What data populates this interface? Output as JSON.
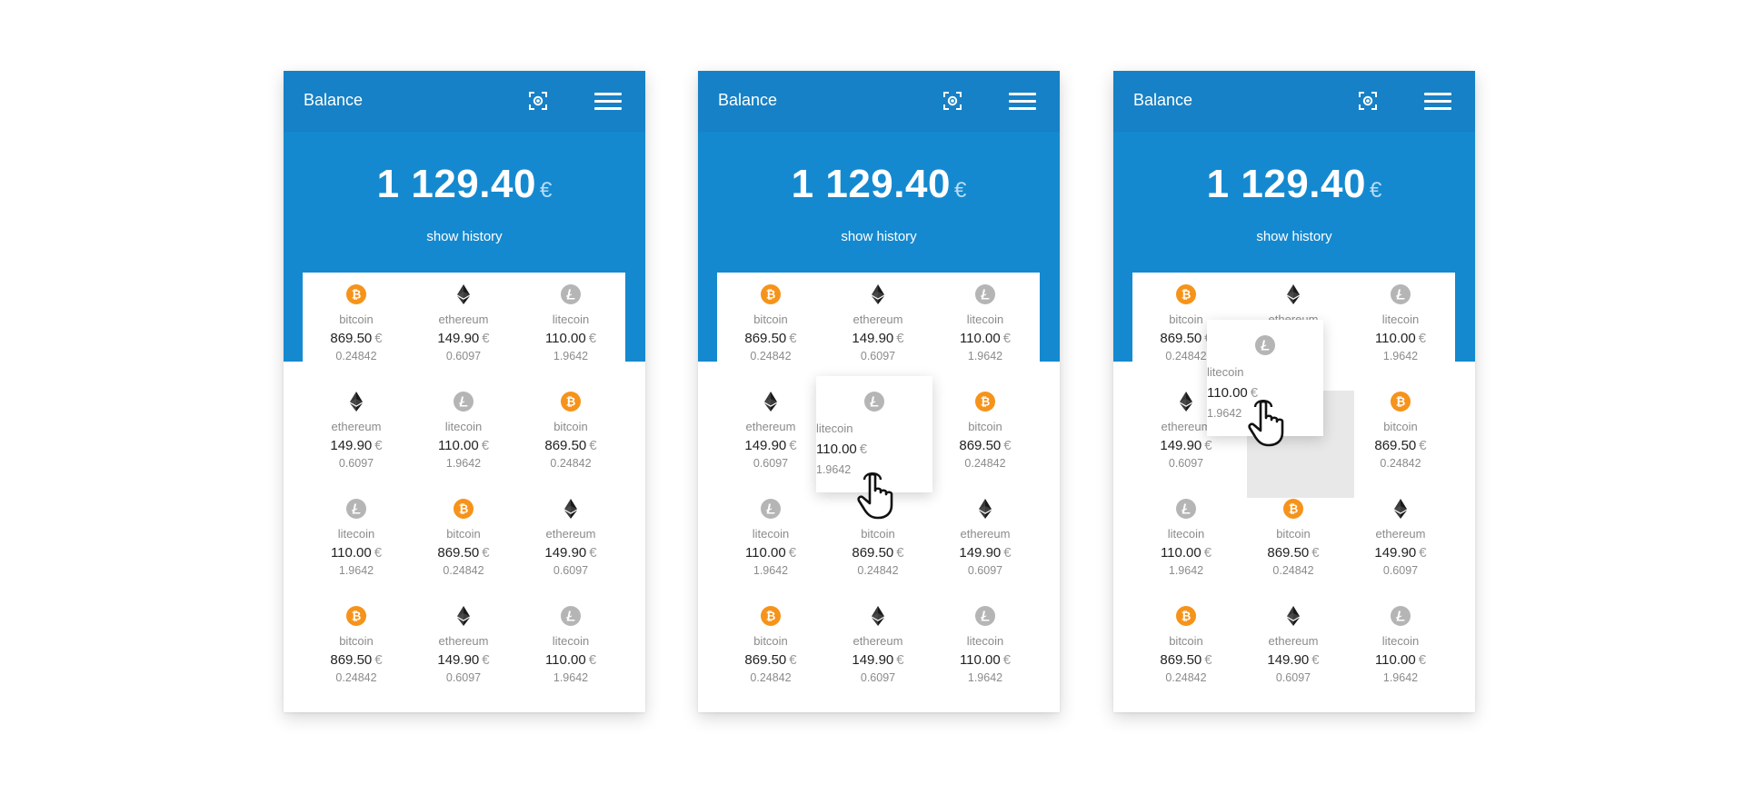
{
  "header": {
    "title": "Balance",
    "total": "1 129.40",
    "currency": "€",
    "history_label": "show history"
  },
  "icons": {
    "scan": "scan-icon",
    "menu": "hamburger-menu-icon",
    "bitcoin": "bitcoin-icon",
    "ethereum": "ethereum-icon",
    "litecoin": "litecoin-icon",
    "cursor": "hand-pointer-icon"
  },
  "colors": {
    "header_blue": "#1589cf",
    "topbar_blue": "#1681c6",
    "bitcoin_orange": "#f6931a",
    "litecoin_gray": "#b5b5b5",
    "ethereum_dark": "#2b2b2b"
  },
  "coins": {
    "bitcoin": {
      "name": "bitcoin",
      "price": "869.50",
      "currency": "€",
      "qty": "0.24842"
    },
    "ethereum": {
      "name": "ethereum",
      "price": "149.90",
      "currency": "€",
      "qty": "0.6097"
    },
    "litecoin": {
      "name": "litecoin",
      "price": "110.00",
      "currency": "€",
      "qty": "1.9642"
    }
  },
  "screens": [
    {
      "state": "default",
      "grid": [
        "bitcoin",
        "ethereum",
        "litecoin",
        "ethereum",
        "litecoin",
        "bitcoin",
        "litecoin",
        "bitcoin",
        "ethereum",
        "bitcoin",
        "ethereum",
        "litecoin"
      ]
    },
    {
      "state": "press",
      "grid": [
        "bitcoin",
        "ethereum",
        "litecoin",
        "ethereum",
        "litecoin",
        "bitcoin",
        "litecoin",
        "bitcoin",
        "ethereum",
        "bitcoin",
        "ethereum",
        "litecoin"
      ],
      "lifted_index": 4
    },
    {
      "state": "drag",
      "grid": [
        "bitcoin",
        "ethereum",
        "litecoin",
        "ethereum",
        "",
        "bitcoin",
        "litecoin",
        "bitcoin",
        "ethereum",
        "bitcoin",
        "ethereum",
        "litecoin"
      ],
      "empty_index": 4,
      "dragged_coin": "litecoin"
    }
  ]
}
